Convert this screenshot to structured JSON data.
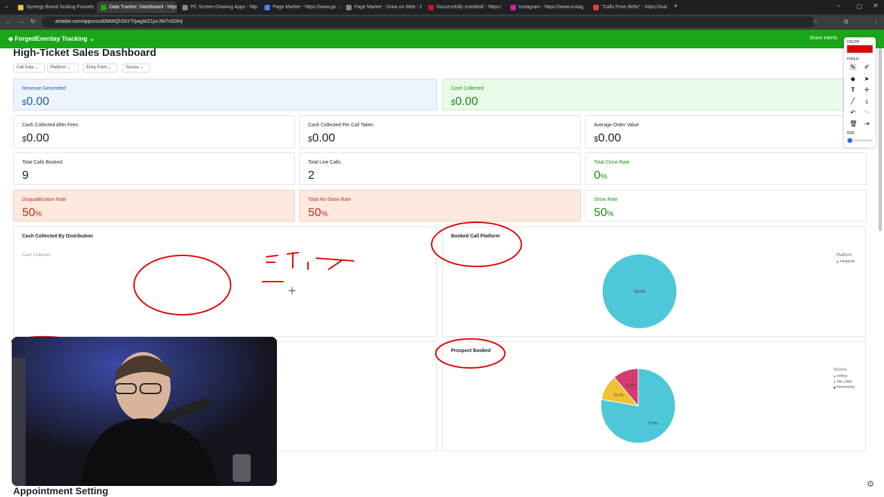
{
  "browser": {
    "tabs": [
      {
        "label": "Synergy Brand Scaling Funnels",
        "color": "#e8c545"
      },
      {
        "label": "Data Tracker: Dashboard - https:",
        "color": "#19a619"
      },
      {
        "label": "PC Screen Drawing Apps - http",
        "color": "#888888"
      },
      {
        "label": "Page Marker - https://www.go",
        "color": "#4285f4"
      },
      {
        "label": "Page Marker - Draw on Web - C",
        "color": "#888888"
      },
      {
        "label": "Successfully Installed! - https:/",
        "color": "#c8102e"
      },
      {
        "label": "Instagram - https://www.instag",
        "color": "#d6249f"
      },
      {
        "label": "\"Calls From Bello\" - https://mai",
        "color": "#ea4335"
      }
    ],
    "url": "airtable.com/appxzzu00MWQhS6YT/pagWZ1jurJW7nSOHj"
  },
  "app": {
    "brand": "ForgedEverday Tracking",
    "share": "Share interfa"
  },
  "dashboard": {
    "title": "High-Ticket Sales Dashboard",
    "filters": [
      "Call Date",
      "Platform",
      "Entry Point",
      "Source"
    ],
    "cards": {
      "revenue": {
        "label": "Revenue Generated",
        "cur": "$",
        "value": "0.00"
      },
      "cash": {
        "label": "Cash Collected",
        "cur": "$",
        "value": "0.00"
      },
      "after_fees": {
        "label": "Cash Collected After Fees",
        "cur": "$",
        "value": "0.00"
      },
      "per_call": {
        "label": "Cash Collected Per Call Taken",
        "cur": "$",
        "value": "0.00"
      },
      "aov": {
        "label": "Average Order Value",
        "cur": "$",
        "value": "0.00"
      },
      "booked": {
        "label": "Total Calls Booked",
        "value": "9"
      },
      "live": {
        "label": "Total Live Calls",
        "value": "2"
      },
      "close": {
        "label": "Total Close Rate",
        "value": "0",
        "unit": "%"
      },
      "disq": {
        "label": "Disqualification Rate",
        "value": "50",
        "unit": "%"
      },
      "noshow": {
        "label": "Total No-Show Rate",
        "value": "50",
        "unit": "%"
      },
      "show": {
        "label": "Show Rate",
        "value": "50",
        "unit": "%"
      }
    },
    "panels": {
      "distribution": {
        "title": "Cash Collected By Distribution",
        "sub": "Cash Collected"
      },
      "platform": {
        "title": "Booked Call Platform",
        "legend_title": "Platform",
        "legend": [
          "instagram"
        ]
      },
      "prospect": {
        "title": "Prospect Booked",
        "legend_title": "Source",
        "legend": [
          "setting",
          "bac_page",
          "freetraining"
        ]
      }
    },
    "section2": "Appointment Setting"
  },
  "toolbar": {
    "color_label": "COLOR",
    "tools_label": "TOOLS",
    "size_label": "SIZE",
    "color": "#e10000"
  },
  "chart_data": [
    {
      "type": "pie",
      "title": "Booked Call Platform",
      "categories": [
        "instagram"
      ],
      "values": [
        100.0
      ],
      "labels": [
        "100.0%"
      ],
      "colors": [
        "#4ec8d8"
      ],
      "legend": "top-right"
    },
    {
      "type": "pie",
      "title": "Prospect Booked",
      "categories": [
        "setting",
        "bac_page",
        "freetraining"
      ],
      "values": [
        77.8,
        11.1,
        11.1
      ],
      "labels": [
        "77.8%",
        "11.1%",
        "11.1%"
      ],
      "colors": [
        "#4ec8d8",
        "#f0c232",
        "#d63a6e"
      ],
      "legend": "top-right"
    }
  ]
}
